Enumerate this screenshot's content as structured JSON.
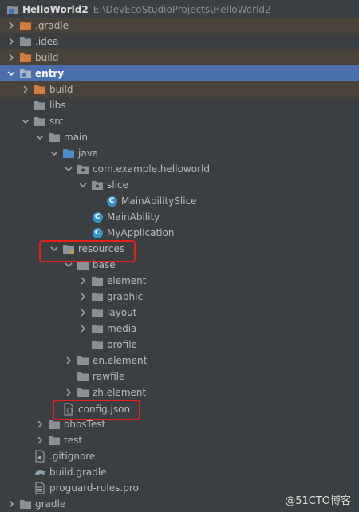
{
  "project": {
    "name": "HelloWorld2",
    "path": "E:\\DevEcoStudioProjects\\HelloWorld2"
  },
  "items": [
    {
      "label": ".gradle"
    },
    {
      "label": ".idea"
    },
    {
      "label": "build"
    },
    {
      "label": "entry"
    },
    {
      "label": "build"
    },
    {
      "label": "libs"
    },
    {
      "label": "src"
    },
    {
      "label": "main"
    },
    {
      "label": "java"
    },
    {
      "label": "com.example.helloworld"
    },
    {
      "label": "slice"
    },
    {
      "label": "MainAbilitySlice"
    },
    {
      "label": "MainAbility"
    },
    {
      "label": "MyApplication"
    },
    {
      "label": "resources"
    },
    {
      "label": "base"
    },
    {
      "label": "element"
    },
    {
      "label": "graphic"
    },
    {
      "label": "layout"
    },
    {
      "label": "media"
    },
    {
      "label": "profile"
    },
    {
      "label": "en.element"
    },
    {
      "label": "rawfile"
    },
    {
      "label": "zh.element"
    },
    {
      "label": "config.json"
    },
    {
      "label": "ohosTest"
    },
    {
      "label": "test"
    },
    {
      "label": ".gitignore"
    },
    {
      "label": "build.gradle"
    },
    {
      "label": "proguard-rules.pro"
    },
    {
      "label": "gradle"
    }
  ],
  "watermark": "@51CTO博客",
  "colors": {
    "background": "#3c3f41",
    "selection": "#4b6eaf",
    "excluded": "#49433a",
    "excluded_folder": "#d07e3b",
    "folder": "#8a9199",
    "class_icon": "#3592c4",
    "highlight": "#e3211d"
  }
}
